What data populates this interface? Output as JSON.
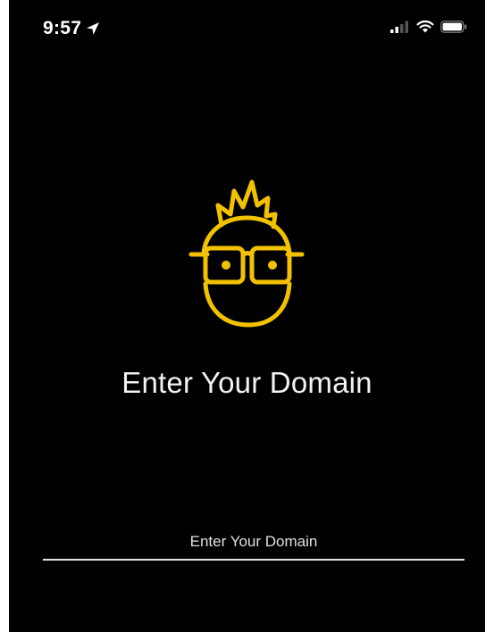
{
  "status_bar": {
    "time": "9:57",
    "location_icon": "location-arrow-icon",
    "signal_icon": "cellular-signal-icon",
    "wifi_icon": "wifi-icon",
    "battery_icon": "battery-icon"
  },
  "logo": {
    "icon": "nerd-face-logo-icon",
    "color": "#f2c200"
  },
  "main": {
    "title": "Enter Your Domain"
  },
  "domain_input": {
    "placeholder": "Enter Your Domain",
    "value": ""
  },
  "colors": {
    "background": "#000000",
    "text": "#ffffff",
    "accent": "#f2c200",
    "underline": "#e6e6e6"
  }
}
